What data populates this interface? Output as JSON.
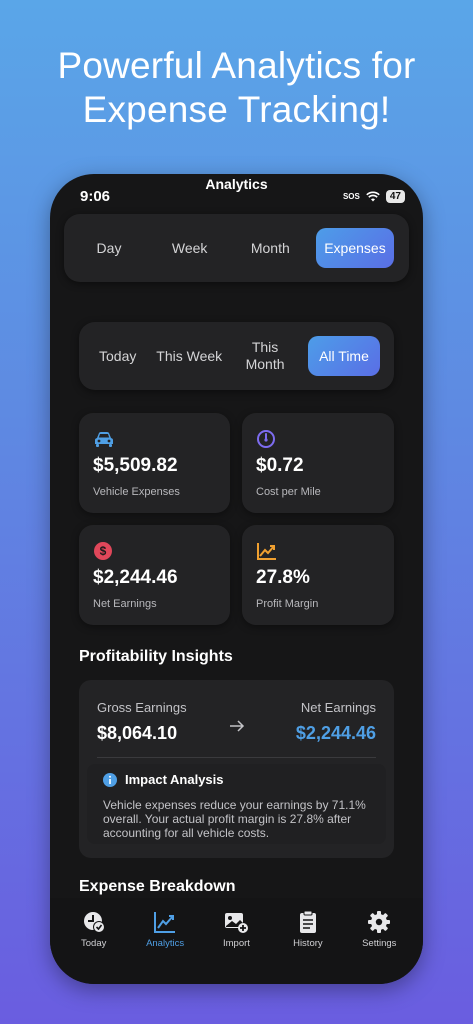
{
  "promo": {
    "headline_line1": "Powerful Analytics for",
    "headline_line2": "Expense Tracking!"
  },
  "status_bar": {
    "time": "9:06",
    "sos": "SOS",
    "battery": "47"
  },
  "screen": {
    "title": "Analytics"
  },
  "period_tabs": {
    "items": [
      "Day",
      "Week",
      "Month",
      "Expenses"
    ],
    "selected": "Expenses"
  },
  "range_tabs": {
    "items": [
      "Today",
      "This Week",
      "This Month",
      "All Time"
    ],
    "selected": "All Time"
  },
  "stats": {
    "vehicle_expenses": {
      "value": "$5,509.82",
      "label": "Vehicle Expenses",
      "icon": "car-icon",
      "color": "#4f9fe5"
    },
    "cost_per_mile": {
      "value": "$0.72",
      "label": "Cost per Mile",
      "icon": "gauge-icon",
      "color": "#7d6cf0"
    },
    "net_earnings": {
      "value": "$2,244.46",
      "label": "Net Earnings",
      "icon": "dollar-icon",
      "color": "#e0475a"
    },
    "profit_margin": {
      "value": "27.8%",
      "label": "Profit Margin",
      "icon": "trend-chart-icon",
      "color": "#f0a030"
    }
  },
  "insights": {
    "title": "Profitability Insights",
    "gross_label": "Gross Earnings",
    "gross_value": "$8,064.10",
    "net_label": "Net Earnings",
    "net_value": "$2,244.46",
    "impact_title": "Impact Analysis",
    "impact_text": "Vehicle expenses reduce your earnings by 71.1% overall. Your actual profit margin is 27.8% after accounting for all vehicle costs."
  },
  "breakdown": {
    "title": "Expense Breakdown"
  },
  "tabbar": {
    "items": [
      {
        "label": "Today",
        "icon": "clock-check-icon"
      },
      {
        "label": "Analytics",
        "icon": "chart-icon"
      },
      {
        "label": "Import",
        "icon": "image-plus-icon"
      },
      {
        "label": "History",
        "icon": "clipboard-icon"
      },
      {
        "label": "Settings",
        "icon": "gear-icon"
      }
    ],
    "active": "Analytics"
  },
  "colors": {
    "accent": "#4f9fe5",
    "background": "#161617",
    "card": "#232325"
  }
}
